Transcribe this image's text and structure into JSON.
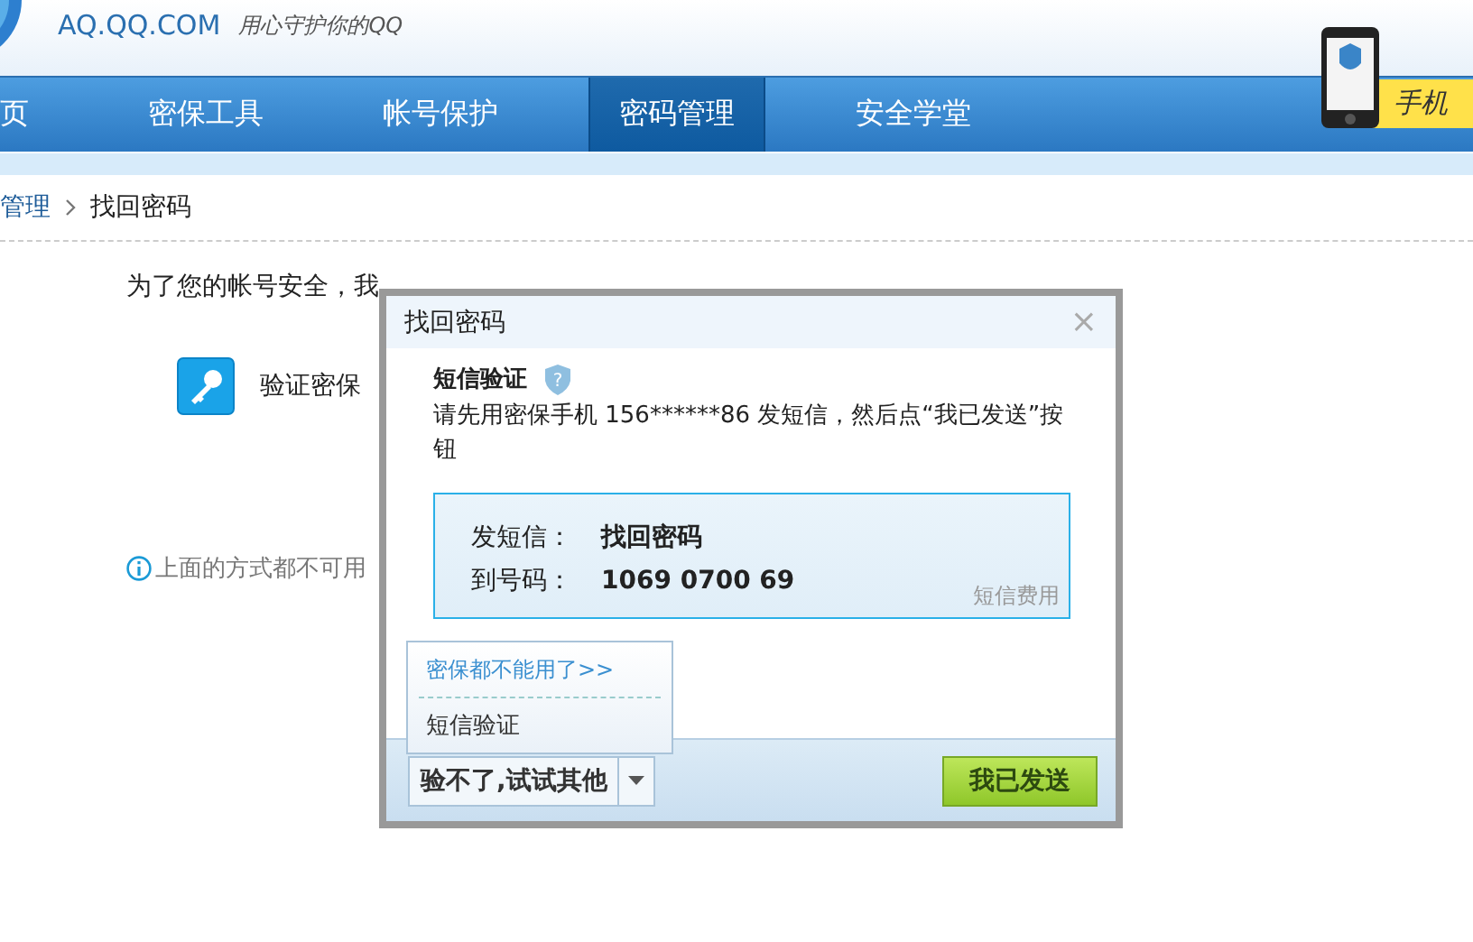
{
  "header": {
    "site": "AQ.QQ.COM",
    "slogan": "用心守护你的QQ",
    "promo": "手机"
  },
  "nav": [
    {
      "label": "页",
      "selected": false
    },
    {
      "label": "密保工具",
      "selected": false
    },
    {
      "label": "帐号保护",
      "selected": false
    },
    {
      "label": "密码管理",
      "selected": true
    },
    {
      "label": "安全学堂",
      "selected": false
    }
  ],
  "breadcrumb": [
    "管理",
    "找回密码"
  ],
  "page": {
    "intro": "为了您的帐号安全，我",
    "method": "验证密保",
    "note": "上面的方式都不可用"
  },
  "dialog": {
    "title": "找回密码",
    "close": "×",
    "heading": "短信验证",
    "help": "?",
    "instruction": "请先用密保手机 156******86 发短信，然后点“我已发送”按钮",
    "sms": [
      {
        "label": "发短信：",
        "value": "找回密码"
      },
      {
        "label": "到号码：",
        "value": "1069 0700 69"
      }
    ],
    "fee_link": "短信费用",
    "menu": [
      {
        "label": "密保都不能用了>>",
        "kind": "link"
      },
      {
        "label": "短信验证",
        "kind": "item"
      }
    ],
    "alt_button": "验不了,试试其他",
    "send_button": "我已发送"
  }
}
